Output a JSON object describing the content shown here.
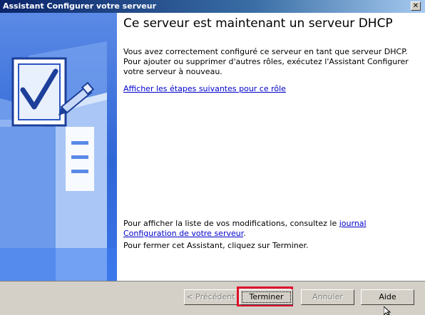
{
  "window": {
    "title": "Assistant Configurer votre serveur",
    "close_glyph": "✕"
  },
  "main": {
    "heading": "Ce serveur est maintenant un serveur DHCP",
    "description": "Vous avez correctement configuré ce serveur en tant que serveur DHCP. Pour ajouter ou supprimer d'autres rôles, exécutez l'Assistant Configurer votre serveur à nouveau.",
    "next_steps_link": "Afficher les étapes suivantes pour ce rôle",
    "changes_prefix": "Pour afficher la liste de vos modifications, consultez le ",
    "changes_link": "journal Configuration de votre serveur",
    "changes_suffix": ".",
    "close_instruction": "Pour fermer cet Assistant, cliquez sur Terminer."
  },
  "buttons": {
    "back": "< Précédent",
    "finish": "Terminer",
    "cancel": "Annuler",
    "help": "Aide"
  },
  "colors": {
    "titlebar": "#0a246a",
    "side_panel": "#2f66d6",
    "highlight": "#e0102c"
  }
}
